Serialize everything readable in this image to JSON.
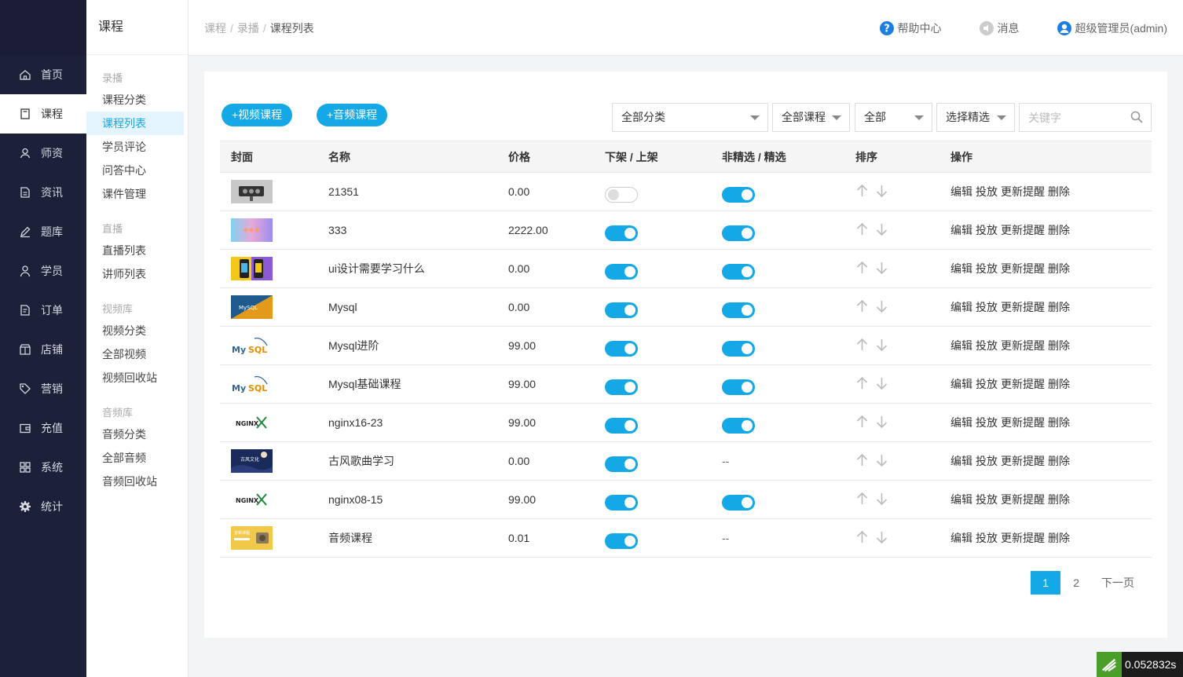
{
  "main_nav": [
    {
      "label": "首页",
      "icon": "home-icon",
      "active": false
    },
    {
      "label": "课程",
      "icon": "book-icon",
      "active": true
    },
    {
      "label": "师资",
      "icon": "teacher-icon",
      "active": false
    },
    {
      "label": "资讯",
      "icon": "news-icon",
      "active": false
    },
    {
      "label": "题库",
      "icon": "pen-icon",
      "active": false
    },
    {
      "label": "学员",
      "icon": "user-icon",
      "active": false
    },
    {
      "label": "订单",
      "icon": "order-icon",
      "active": false
    },
    {
      "label": "店铺",
      "icon": "shop-icon",
      "active": false
    },
    {
      "label": "营销",
      "icon": "tag-icon",
      "active": false
    },
    {
      "label": "充值",
      "icon": "wallet-icon",
      "active": false
    },
    {
      "label": "系统",
      "icon": "grid-icon",
      "active": false
    },
    {
      "label": "统计",
      "icon": "gear-icon",
      "active": false
    }
  ],
  "sub_nav": {
    "title": "课程",
    "groups": [
      {
        "label": "录播",
        "items": [
          {
            "label": "课程分类",
            "active": false
          },
          {
            "label": "课程列表",
            "active": true
          },
          {
            "label": "学员评论",
            "active": false
          },
          {
            "label": "问答中心",
            "active": false
          },
          {
            "label": "课件管理",
            "active": false
          }
        ]
      },
      {
        "label": "直播",
        "items": [
          {
            "label": "直播列表",
            "active": false
          },
          {
            "label": "讲师列表",
            "active": false
          }
        ]
      },
      {
        "label": "视频库",
        "items": [
          {
            "label": "视频分类",
            "active": false
          },
          {
            "label": "全部视频",
            "active": false
          },
          {
            "label": "视频回收站",
            "active": false
          }
        ]
      },
      {
        "label": "音频库",
        "items": [
          {
            "label": "音频分类",
            "active": false
          },
          {
            "label": "全部音频",
            "active": false
          },
          {
            "label": "音频回收站",
            "active": false
          }
        ]
      }
    ]
  },
  "header": {
    "breadcrumb": [
      "课程",
      "录播",
      "课程列表"
    ],
    "help": "帮助中心",
    "messages": "消息",
    "user": "超级管理员(admin)"
  },
  "toolbar": {
    "add_video": "+视频课程",
    "add_audio": "+音频课程",
    "filters": [
      "全部分类",
      "全部课程",
      "全部",
      "选择精选"
    ],
    "search_placeholder": "关键字"
  },
  "table": {
    "columns": [
      "封面",
      "名称",
      "价格",
      "下架 / 上架",
      "非精选 / 精选",
      "排序",
      "操作"
    ],
    "actions": [
      "编辑",
      "投放",
      "更新提醒",
      "删除"
    ],
    "rows": [
      {
        "name": "21351",
        "price": "0.00",
        "on_shelf": false,
        "featured": true,
        "thumb": "device"
      },
      {
        "name": "333",
        "price": "2222.00",
        "on_shelf": true,
        "featured": true,
        "thumb": "gradient"
      },
      {
        "name": "ui设计需要学习什么",
        "price": "0.00",
        "on_shelf": true,
        "featured": true,
        "thumb": "phones"
      },
      {
        "name": "Mysql",
        "price": "0.00",
        "on_shelf": true,
        "featured": true,
        "thumb": "mysql-banner"
      },
      {
        "name": "Mysql进阶",
        "price": "99.00",
        "on_shelf": true,
        "featured": true,
        "thumb": "mysql-logo"
      },
      {
        "name": "Mysql基础课程",
        "price": "99.00",
        "on_shelf": true,
        "featured": true,
        "thumb": "mysql-logo"
      },
      {
        "name": "nginx16-23",
        "price": "99.00",
        "on_shelf": true,
        "featured": true,
        "thumb": "nginx-logo"
      },
      {
        "name": "古风歌曲学习",
        "price": "0.00",
        "on_shelf": true,
        "featured": null,
        "thumb": "night"
      },
      {
        "name": "nginx08-15",
        "price": "99.00",
        "on_shelf": true,
        "featured": true,
        "thumb": "nginx-logo"
      },
      {
        "name": "音频课程",
        "price": "0.01",
        "on_shelf": true,
        "featured": null,
        "thumb": "audio"
      }
    ],
    "not_applicable": "--"
  },
  "pagination": {
    "pages": [
      "1",
      "2"
    ],
    "current": "1",
    "next": "下一页"
  },
  "timer": "0.052832s",
  "colors": {
    "accent": "#14a8e6",
    "sidebar": "#1c2038"
  }
}
